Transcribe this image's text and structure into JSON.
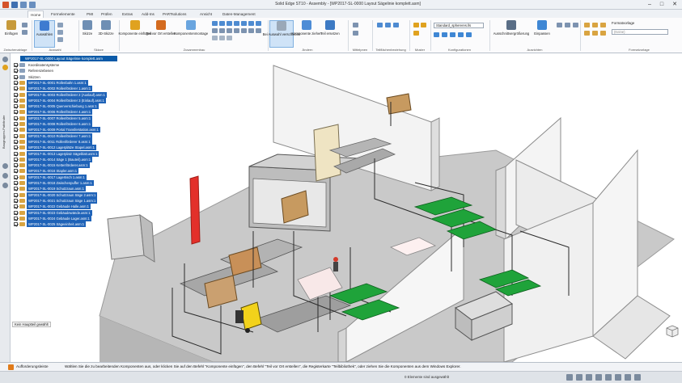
{
  "window": {
    "title": "Solid Edge ST10 - Assembly - [WP2017-SL-0000 Layout Sägelinie komplett.asm]",
    "minimize": "–",
    "maximize": "□",
    "close": "✕"
  },
  "tabs": [
    "Home",
    "Formelemente",
    "PMI",
    "Prüfen",
    "Extras",
    "Add-Ins",
    "PARTsolutions",
    "Ansicht",
    "Daten-Management"
  ],
  "ribbon": {
    "tools": [
      {
        "label": "Einfügen",
        "color": "#c79a3b"
      },
      {
        "label": "Auswählen",
        "color": "#3e7bd0",
        "selected": true
      },
      {
        "label": "Skizze",
        "color": "#6f8fb4"
      },
      {
        "label": "3D-Skizze",
        "color": "#6f8fb4"
      },
      {
        "label": "Komponente einfügen",
        "color": "#e0a21f"
      },
      {
        "label": "Teil vor Ort erstellen",
        "color": "#d46b1f"
      },
      {
        "label": "Komponentenmontage",
        "color": "#6aa5df"
      },
      {
        "label": "Bei Auswahl verschieben",
        "color": "#9aa8b8",
        "selected": true
      },
      {
        "label": "Komponente ziehen",
        "color": "#4d8cd6"
      },
      {
        "label": "Teil ersetzen",
        "color": "#3d7ac4"
      },
      {
        "label": "Ausschnittvergrößerung",
        "color": "#5a6e86"
      },
      {
        "label": "Einpassen",
        "color": "#3f87d4"
      }
    ],
    "groups": [
      "Zwischenablage",
      "Auswahl",
      "Skizze",
      "Zusammenbau",
      "Ändern",
      "Muster",
      "Konfigurationen",
      "Ausrichten",
      "Formatvorlage"
    ],
    "other_groups": [
      "Mittelpnen",
      "Teilflächenbeziehung"
    ],
    "config_combo": "Standard_sphereres.lls",
    "style_label": "Formatvorlage",
    "style_combo": "(Keine)"
  },
  "left_tab": {
    "label": "Baugruppen-Pathfinder"
  },
  "tree": {
    "header": "WP2017-SL-0000 Layout Sägelinie komplett.asm",
    "rows": [
      {
        "text": "Koordinatensysteme",
        "plain": true
      },
      {
        "text": "Referenzebenen",
        "plain": true
      },
      {
        "text": "Skizzen",
        "plain": true
      },
      {
        "text": "WP2017-SL-0001 Rollenbahn 1.asm:1"
      },
      {
        "text": "WP2017-SL-0002 Rollenförderer 1.asm:1"
      },
      {
        "text": "WP2017-SL-0003 Rollenförderer 2 (Auslauf).asm:1"
      },
      {
        "text": "WP2017-SL-0004 Rollenförderer 3 (Einlauf).asm:1"
      },
      {
        "text": "WP2017-SL-0005 Querverschiebung 1.asm:1"
      },
      {
        "text": "WP2017-SL-0006 Rollenförderer 4.asm:1"
      },
      {
        "text": "WP2017-SL-0007 Rollenförderer 5.asm:1"
      },
      {
        "text": "WP2017-SL-0008 Rollenförderer 6.asm:1"
      },
      {
        "text": "WP2017-SL-0009 Portal Transferstation.asm:1"
      },
      {
        "text": "WP2017-SL-0010 Rollenförderer 7.asm:1"
      },
      {
        "text": "WP2017-SL-0011 Rollenförderer 8.asm:1"
      },
      {
        "text": "WP2017-SL-0012 Lagerplätze Stapel.asm:1"
      },
      {
        "text": "WP2017-SL-0013 Lagerplatz Sägeblatt.asm:1"
      },
      {
        "text": "WP2017-SL-0014 Säge 1 (Bauteil).asm:1"
      },
      {
        "text": "WP2017-SL-0015 Kettenförderer.asm:1"
      },
      {
        "text": "WP2017-SL-0016 Stapler.asm:1"
      },
      {
        "text": "WP2017-SL-0017 Lagertisch 1.asm:1"
      },
      {
        "text": "WP2017-SL-0018 Zwischenpuffer 1.asm:1"
      },
      {
        "text": "WP2017-SL-0019 Schutzzaun.asm:1"
      },
      {
        "text": "WP2017-SL-0020 Schutzzaun Säge 2.asm:1"
      },
      {
        "text": "WP2017-SL-0021 Schutzzaun Säge 1.asm:1"
      },
      {
        "text": "WP2017-SL-0022 Gebäude Halle.asm:1"
      },
      {
        "text": "WP2017-SL-0023 Gebäudewände.asm:1"
      },
      {
        "text": "WP2017-SL-0024 Gebäude Lager.asm:1"
      },
      {
        "text": "WP2017-SL-0025 Sägeeinheit.asm:1"
      }
    ]
  },
  "viewport": {
    "status": "Kein Hauptteil gewählt"
  },
  "command_bar": {
    "label": "Aufforderungsleiste",
    "prompt": "Wählen Sie die zu bearbeitenden Komponenten aus, oder klicken Sie auf den Befehl \"Komponente einfügen\", den Befehl \"Teil vor Ort erstellen\", die Registerkarte \"Teilbibliothek\", oder ziehen Sie die Komponenten aus dem Windows Explorer."
  },
  "status_bar": {
    "elements": "0 Elemente sind ausgewählt"
  },
  "colors": {
    "accent": "#1f63b8",
    "tree_header": "#0b5aa8",
    "conveyor_green": "#1fa33a",
    "forklift_yellow": "#f2d21b",
    "pillar_red": "#e3302a"
  }
}
